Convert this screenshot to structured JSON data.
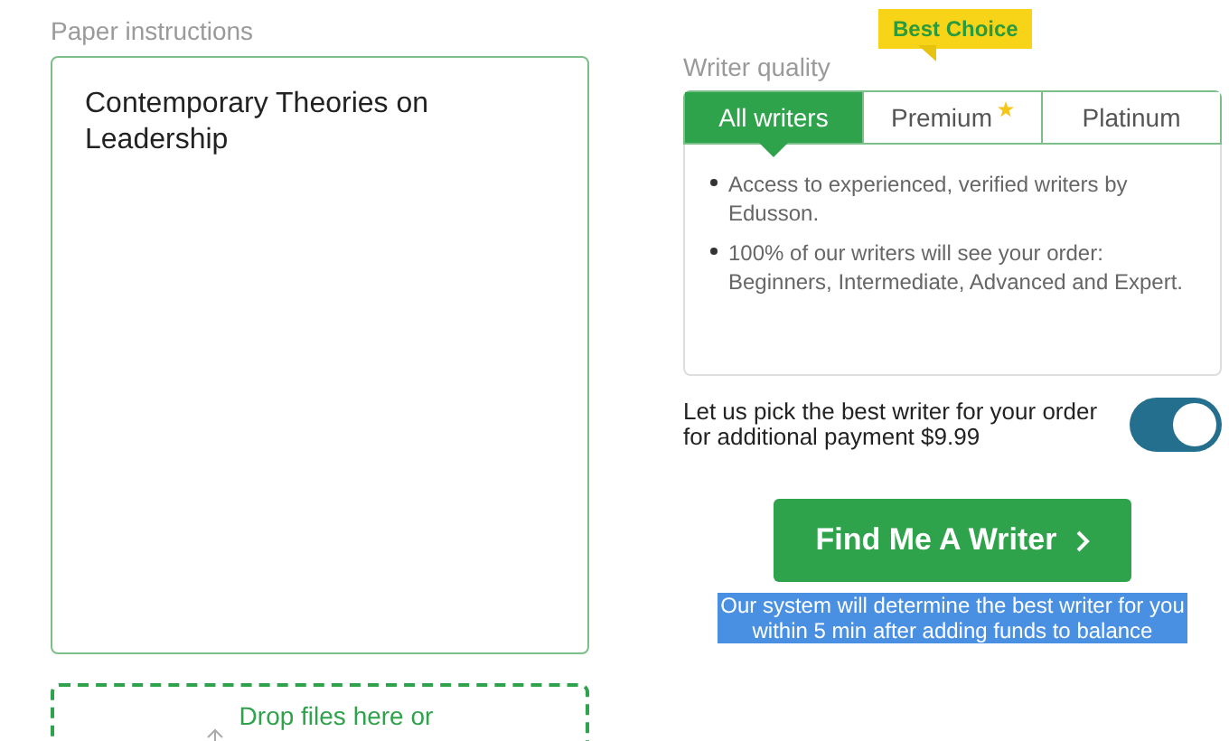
{
  "instructions": {
    "label": "Paper instructions",
    "value": "Contemporary Theories on Leadership"
  },
  "upload": {
    "text": "Drop files here or"
  },
  "writer_quality": {
    "label": "Writer quality",
    "badge": "Best Choice",
    "tabs": [
      {
        "label": "All writers",
        "selected": true,
        "starred": false
      },
      {
        "label": "Premium",
        "selected": false,
        "starred": true
      },
      {
        "label": "Platinum",
        "selected": false,
        "starred": false
      }
    ],
    "features": [
      "Access to experienced, verified writers by Edusson.",
      "100% of our writers will see your order: Beginners, Intermediate, Advanced and Expert."
    ]
  },
  "auto_pick": {
    "text": "Let us pick the best writer for your order for additional payment $9.99",
    "on": true
  },
  "submit": {
    "label": "Find Me A Writer",
    "caption": "Our system will determine the best writer for you within 5 min after adding funds to balance",
    "caption_selected": true
  }
}
